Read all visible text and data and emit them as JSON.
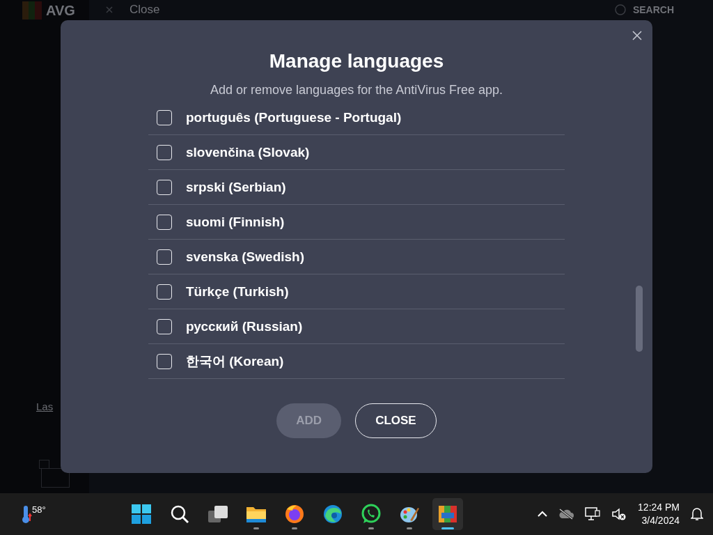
{
  "background_app": {
    "logo": "AVG",
    "header_close": "Close",
    "search": "SEARCH",
    "link_fragment": "Las"
  },
  "dialog": {
    "title": "Manage languages",
    "subtitle": "Add or remove languages for the AntiVirus Free app.",
    "languages": [
      {
        "label": "português (Portuguese - Portugal)",
        "checked": false
      },
      {
        "label": "slovenčina (Slovak)",
        "checked": false
      },
      {
        "label": "srpski (Serbian)",
        "checked": false
      },
      {
        "label": "suomi (Finnish)",
        "checked": false
      },
      {
        "label": "svenska (Swedish)",
        "checked": false
      },
      {
        "label": "Türkçe (Turkish)",
        "checked": false
      },
      {
        "label": "русский (Russian)",
        "checked": false
      },
      {
        "label": "한국어 (Korean)",
        "checked": false
      }
    ],
    "buttons": [
      {
        "label": "ADD",
        "kind": "filled",
        "disabled": true
      },
      {
        "label": "CLOSE",
        "kind": "outline",
        "disabled": false
      }
    ]
  },
  "taskbar": {
    "weather": "58°",
    "apps": [
      {
        "kind": "start",
        "running": false,
        "selected": false
      },
      {
        "kind": "search",
        "running": false,
        "selected": false
      },
      {
        "kind": "taskview",
        "running": false,
        "selected": false
      },
      {
        "kind": "files",
        "running": true,
        "selected": false
      },
      {
        "kind": "firefox",
        "running": true,
        "selected": false
      },
      {
        "kind": "edge",
        "running": false,
        "selected": false
      },
      {
        "kind": "whatsapp",
        "running": true,
        "selected": false
      },
      {
        "kind": "paint",
        "running": true,
        "selected": false
      },
      {
        "kind": "avg",
        "running": true,
        "selected": true
      }
    ],
    "time": "12:24 PM",
    "date": "3/4/2024"
  }
}
